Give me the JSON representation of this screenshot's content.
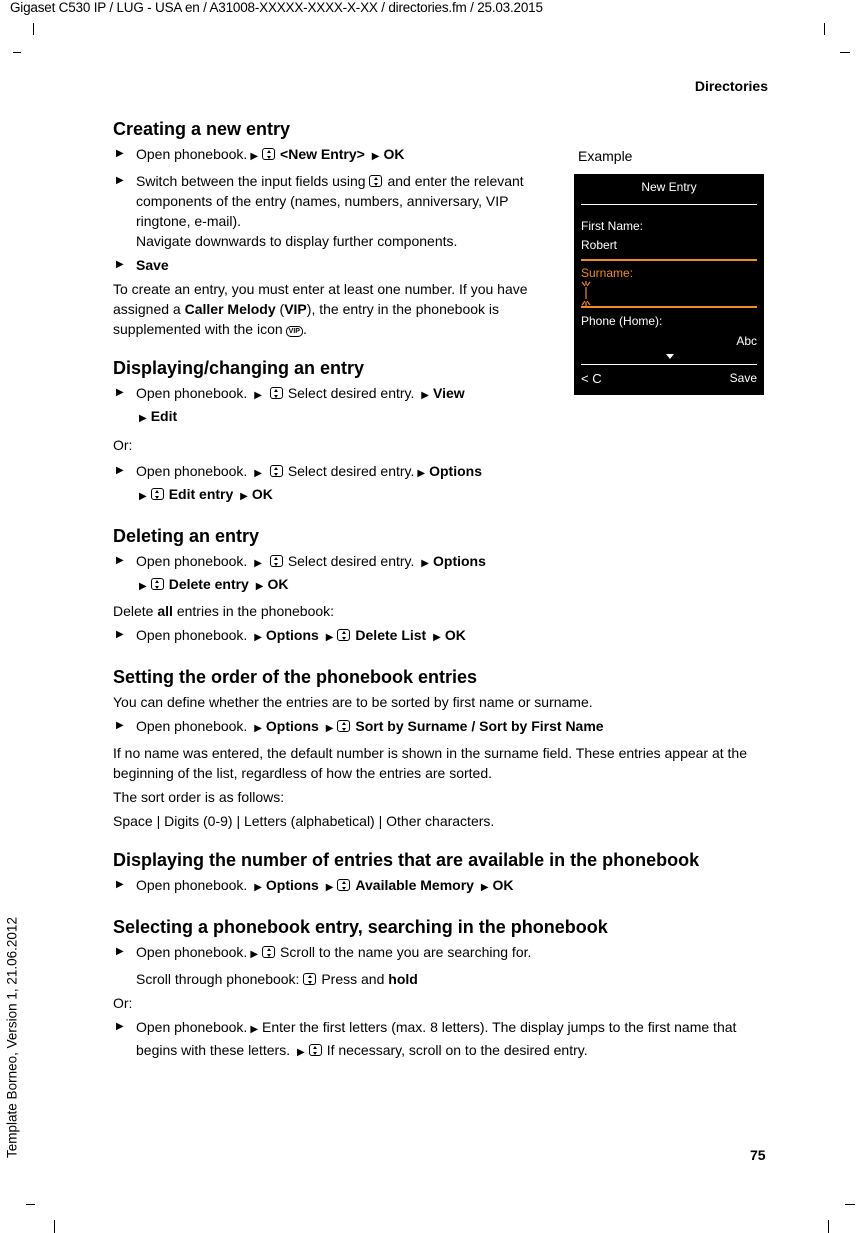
{
  "header": {
    "doc_line": "Gigaset C530 IP / LUG - USA en / A31008-XXXXX-XXXX-X-XX / directories.fm / 25.03.2015",
    "section": "Directories"
  },
  "sidebar_text": "Template Borneo, Version 1, 21.06.2012",
  "page_number": "75",
  "sections": {
    "creating": {
      "title": "Creating a new entry",
      "step1": {
        "a": "Open phonebook.",
        "b": "<New Entry>",
        "c": "OK"
      },
      "step2": {
        "a": "Switch between the input fields using",
        "b": "and enter the relevant components of the entry (names, numbers, anniversary, VIP ringtone, e-mail).",
        "c": "Navigate downwards to display further components."
      },
      "step3": "Save",
      "note": {
        "a": "To create an entry, you must enter at least one number. If you have assigned a",
        "b": "Caller Melody",
        "c": "(",
        "d": "VIP",
        "e": "), the entry in the phonebook is supplemented with the icon",
        "f": ".",
        "vip_icon": "VIP"
      }
    },
    "displaying": {
      "title": "Displaying/changing an entry",
      "step1": {
        "a": "Open phonebook.",
        "b": "Select desired entry.",
        "c": "View",
        "d": "Edit"
      },
      "or": "Or:",
      "step2": {
        "a": "Open phonebook.",
        "b": "Select desired entry.",
        "c": "Options",
        "d": "Edit entry",
        "e": "OK"
      }
    },
    "deleting": {
      "title": "Deleting an entry",
      "step1": {
        "a": "Open phonebook.",
        "b": "Select desired entry.",
        "c": "Options",
        "d": "Delete entry",
        "e": "OK"
      },
      "delete_all": {
        "a": "Delete",
        "b": "all",
        "c": "entries in the phonebook:"
      },
      "step2": {
        "a": "Open phonebook.",
        "b": "Options",
        "c": "Delete List",
        "d": "OK"
      }
    },
    "order": {
      "title": "Setting the order of the phonebook entries",
      "intro": "You can define whether the entries are to be sorted by first name or surname.",
      "step1": {
        "a": "Open phonebook.",
        "b": "Options",
        "c": "Sort by Surname / Sort by First Name"
      },
      "note": "If no name was entered, the default number is shown in the surname field. These entries appear at the beginning of the list, regardless of how the entries are sorted.",
      "sort_intro": "The sort order is as follows:",
      "sort_order": "Space | Digits (0-9) | Letters (alphabetical) | Other characters."
    },
    "available": {
      "title": "Displaying the number of entries that are available in the phonebook",
      "step1": {
        "a": "Open phonebook.",
        "b": "Options",
        "c": "Available Memory",
        "d": "OK"
      }
    },
    "selecting": {
      "title": "Selecting a phonebook entry, searching in the phonebook",
      "step1": {
        "a": "Open phonebook.",
        "b": "Scroll to the name you are searching for."
      },
      "scroll": {
        "a": "Scroll through phonebook:",
        "b": "Press and",
        "c": "hold"
      },
      "or": "Or:",
      "step2": {
        "a": "Open phonebook.",
        "b": "Enter the first letters (max. 8 letters). The display jumps to the first name that begins with these letters.",
        "c": "If necessary, scroll on to the desired entry."
      }
    }
  },
  "example": {
    "label": "Example",
    "screen_title": "New Entry",
    "field1_label": "First Name:",
    "field1_value": "Robert",
    "field2_label": "Surname:",
    "field3_label": "Phone (Home):",
    "input_mode": "Abc",
    "softkey_left": "< C",
    "softkey_right": "Save",
    "accent_color": "#f08a24"
  },
  "glyphs": {
    "step_marker": "▶",
    "inline_marker": "▶"
  }
}
